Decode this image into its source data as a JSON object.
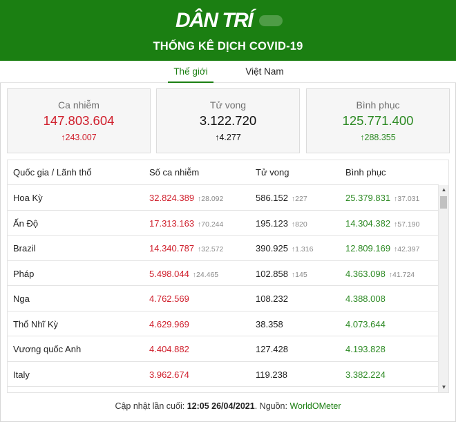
{
  "header": {
    "logo": "DÂN TRÍ",
    "title": "THỐNG KÊ DỊCH COVID-19"
  },
  "tabs": [
    {
      "label": "Thế giới",
      "active": true
    },
    {
      "label": "Việt Nam",
      "active": false
    }
  ],
  "summary": {
    "cases": {
      "label": "Ca nhiễm",
      "value": "147.803.604",
      "delta": "243.007"
    },
    "deaths": {
      "label": "Tử vong",
      "value": "3.122.720",
      "delta": "4.277"
    },
    "recovered": {
      "label": "Bình phục",
      "value": "125.771.400",
      "delta": "288.355"
    }
  },
  "table": {
    "headers": [
      "Quốc gia / Lãnh thổ",
      "Số ca nhiễm",
      "Tử vong",
      "Bình phục"
    ],
    "rows": [
      {
        "country": "Hoa Kỳ",
        "cases": "32.824.389",
        "cases_delta": "28.092",
        "deaths": "586.152",
        "deaths_delta": "227",
        "recovered": "25.379.831",
        "recovered_delta": "37.031"
      },
      {
        "country": "Ấn Độ",
        "cases": "17.313.163",
        "cases_delta": "70.244",
        "deaths": "195.123",
        "deaths_delta": "820",
        "recovered": "14.304.382",
        "recovered_delta": "57.190"
      },
      {
        "country": "Brazil",
        "cases": "14.340.787",
        "cases_delta": "32.572",
        "deaths": "390.925",
        "deaths_delta": "1.316",
        "recovered": "12.809.169",
        "recovered_delta": "42.397"
      },
      {
        "country": "Pháp",
        "cases": "5.498.044",
        "cases_delta": "24.465",
        "deaths": "102.858",
        "deaths_delta": "145",
        "recovered": "4.363.098",
        "recovered_delta": "41.724"
      },
      {
        "country": "Nga",
        "cases": "4.762.569",
        "cases_delta": "",
        "deaths": "108.232",
        "deaths_delta": "",
        "recovered": "4.388.008",
        "recovered_delta": ""
      },
      {
        "country": "Thổ Nhĩ Kỳ",
        "cases": "4.629.969",
        "cases_delta": "",
        "deaths": "38.358",
        "deaths_delta": "",
        "recovered": "4.073.644",
        "recovered_delta": ""
      },
      {
        "country": "Vương quốc Anh",
        "cases": "4.404.882",
        "cases_delta": "",
        "deaths": "127.428",
        "deaths_delta": "",
        "recovered": "4.193.828",
        "recovered_delta": ""
      },
      {
        "country": "Italy",
        "cases": "3.962.674",
        "cases_delta": "",
        "deaths": "119.238",
        "deaths_delta": "",
        "recovered": "3.382.224",
        "recovered_delta": ""
      }
    ]
  },
  "footer": {
    "prefix": "Cập nhật lần cuối: ",
    "time": "12:05 26/04/2021",
    "mid": ". Nguồn: ",
    "source": "WorldOMeter"
  },
  "colors": {
    "brand_green": "#1b7f12",
    "cases_red": "#d0202d",
    "recovered_green": "#2d8a24"
  },
  "icons": {
    "delta": "arrow-up-icon",
    "scroll_up": "triangle-up-icon",
    "scroll_down": "triangle-down-icon"
  }
}
